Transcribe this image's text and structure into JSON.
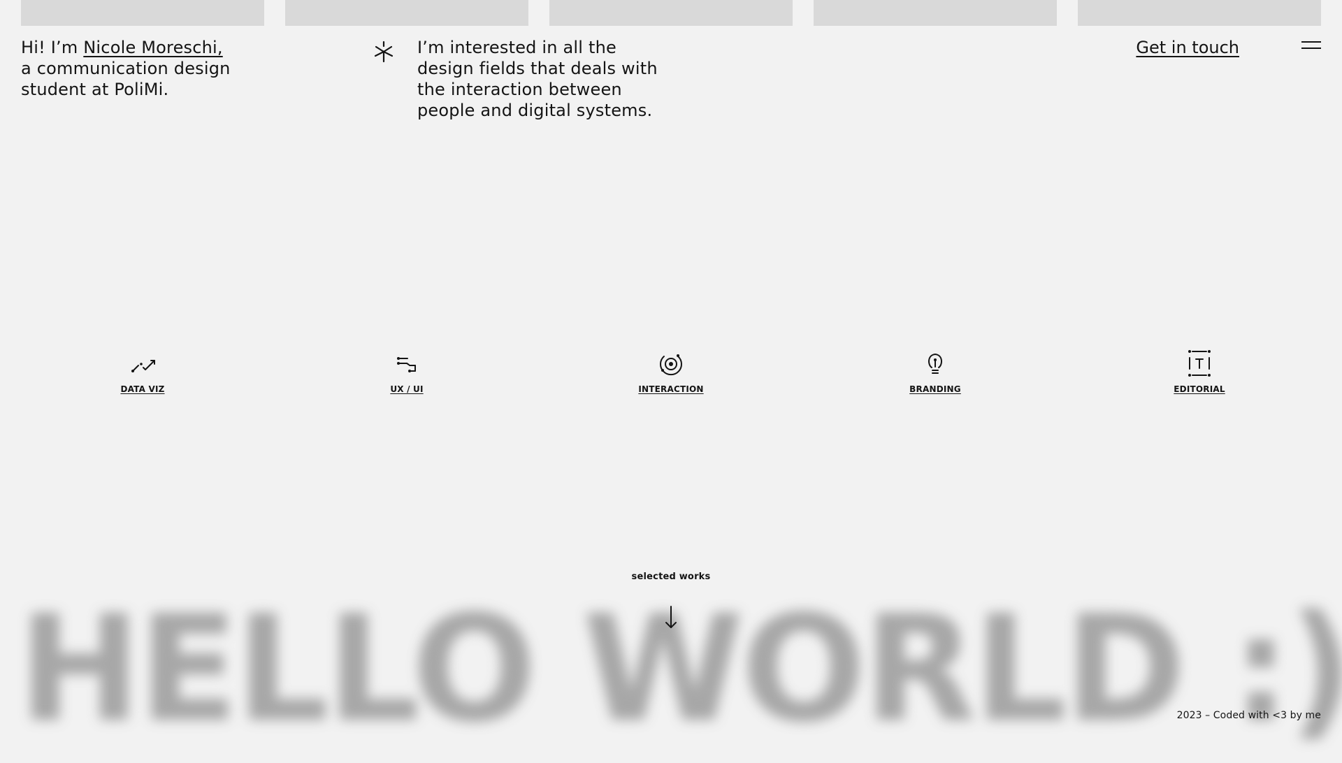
{
  "intro": {
    "greeting": "Hi! I’m ",
    "name": "Nicole Moreschi,",
    "line2": "a communication design",
    "line3": "student at PoliMi."
  },
  "interest": {
    "line1": "I’m interested in all the",
    "line2": "design fields that deals with",
    "line3": "the interaction between",
    "line4": "people and digital systems."
  },
  "nav": {
    "contact_label": "Get in touch",
    "menu_icon": "hamburger-menu-icon"
  },
  "categories": [
    {
      "label": "DATA VIZ",
      "icon": "chart-trend-icon"
    },
    {
      "label": "UX / UI",
      "icon": "flow-icon"
    },
    {
      "label": "INTERACTION",
      "icon": "target-orbit-icon"
    },
    {
      "label": "BRANDING",
      "icon": "lightbulb-icon"
    },
    {
      "label": "EDITORIAL",
      "icon": "text-frame-icon"
    }
  ],
  "selected_works_label": "selected works",
  "hero_text": "HELLO WORLD :)",
  "footer_text": "2023 – Coded with <3 by me",
  "colors": {
    "background": "#f2f2f2",
    "bar": "#d9d9d9",
    "text": "#141414",
    "blurred_text": "#9a9a9a"
  }
}
